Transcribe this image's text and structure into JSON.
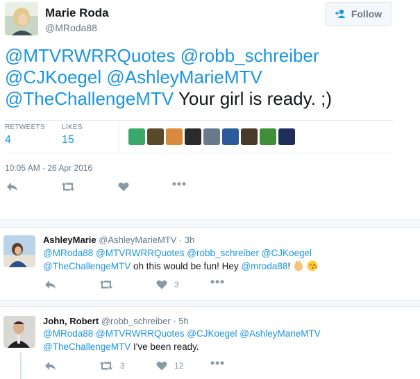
{
  "main_tweet": {
    "author_name": "Marie Roda",
    "author_handle": "@MRoda88",
    "follow_label": "Follow",
    "mentions_line1": [
      "@MTVRWRRQuotes",
      "@robb_schreiber"
    ],
    "mentions_line2": [
      "@CJKoegel",
      "@AshleyMarieMTV"
    ],
    "mention_line3": "@TheChallengeMTV",
    "text_tail": "Your girl is ready. ;)",
    "retweets_label": "RETWEETS",
    "retweets_count": "4",
    "likes_label": "LIKES",
    "likes_count": "15",
    "timestamp": "10:05 AM - 26 Apr 2016",
    "liker_colors": [
      "#3aa86b",
      "#5a4a2a",
      "#d98a3a",
      "#2b2b2b",
      "#6a7a8c",
      "#2d5a9a",
      "#4a3a2a",
      "#3f8f3a",
      "#1f2f5a"
    ]
  },
  "replies": [
    {
      "author_name": "AshleyMarie",
      "author_handle": "@AshleyMarieMTV",
      "time": "· 3h",
      "line1": [
        "@MRoda88",
        "@MTVRWRRQuotes",
        "@robb_schreiber",
        "@CJKoegel"
      ],
      "line2_mention": "@TheChallengeMTV",
      "line2_text": " oh this would be fun! Hey ",
      "line2_mention2": "@mroda88",
      "line2_end": "!",
      "like_count": "3",
      "retweet_count": ""
    },
    {
      "author_name": "John, Robert",
      "author_handle": "@robb_schreiber",
      "time": "· 5h",
      "line1": [
        "@MRoda88",
        "@MTVRWRRQuotes",
        "@CJKoegel",
        "@AshleyMarieMTV"
      ],
      "line2_mention": "@TheChallengeMTV",
      "line2_text": " I've been ready.",
      "like_count": "12",
      "retweet_count": "3"
    }
  ],
  "colors": {
    "link": "#1b95e0",
    "secondary": "#657786",
    "icon": "#8899a6"
  }
}
